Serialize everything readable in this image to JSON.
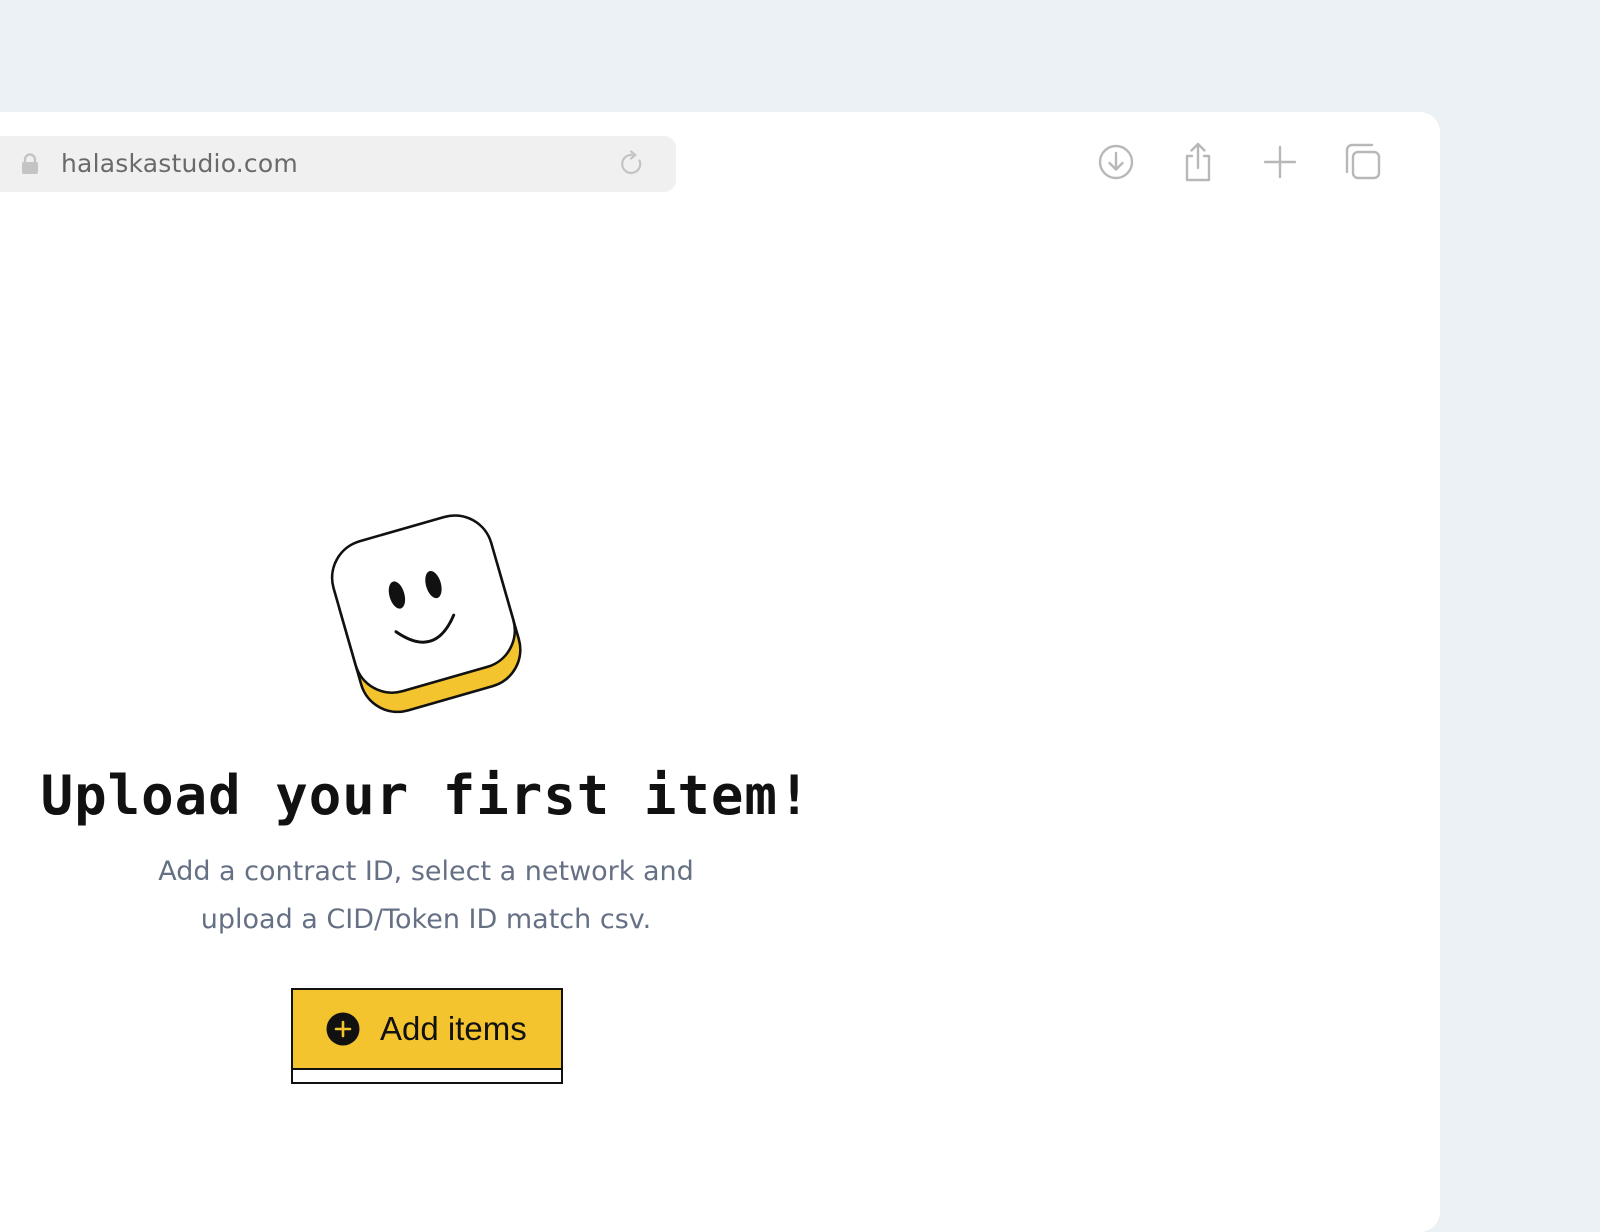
{
  "browser": {
    "url": "halaskastudio.com",
    "toolbar_icons": [
      "download-icon",
      "share-icon",
      "new-tab-icon",
      "tabs-overview-icon"
    ]
  },
  "empty_state": {
    "illustration": "smiling-cube-mascot",
    "title": "Upload your first item!",
    "description_line1": "Add a contract ID, select a network and",
    "description_line2": "upload a CID/Token ID match csv.",
    "button_label": "Add items",
    "button_icon": "plus-circle-icon"
  },
  "colors": {
    "page_background": "#ebf1f5",
    "accent_yellow": "#f4c42f",
    "text_dark": "#111111",
    "text_muted": "#667085",
    "icon_gray": "#b8b8b8"
  }
}
